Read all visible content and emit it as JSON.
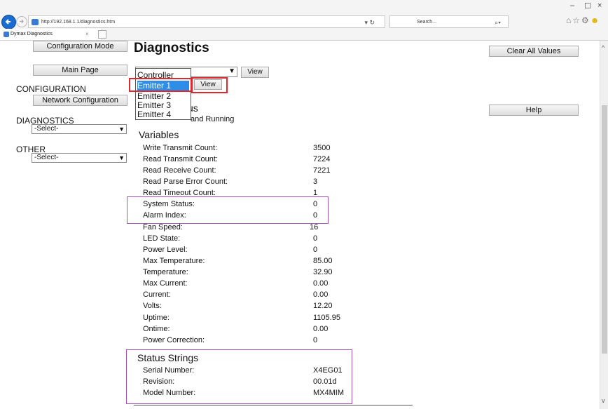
{
  "browser": {
    "url": "http://192.168.1.1/diagnostics.htm",
    "refresh_icon": "refresh-icon",
    "search_placeholder": "Search...",
    "search_icon": "search-icon",
    "tab_title": "Dymax Diagnostics",
    "tab_close": "×",
    "window_controls": {
      "minimize": "–",
      "maximize": "☐",
      "close": "×"
    },
    "toolbar_icons": [
      "home-icon",
      "star-icon",
      "gear-icon",
      "smiley-icon"
    ]
  },
  "sidebar": {
    "configuration_mode": "Configuration Mode",
    "main_page": "Main Page",
    "configuration_heading": "CONFIGURATION",
    "network_configuration": "Network Configuration",
    "diagnostics_heading": "DIAGNOSTICS",
    "diagnostics_select": "-Select-",
    "other_heading": "OTHER",
    "other_select": "-Select-"
  },
  "main": {
    "title": "Diagnostics",
    "view_button": "View",
    "view_button_2": "View",
    "clear_all": "Clear All Values",
    "help": "Help",
    "dropdown_options": [
      "Controller",
      "Emitter 1",
      "Emitter 2",
      "Emitter 3",
      "Emitter 4"
    ],
    "dropdown_selected": "Emitter 1",
    "status_heading_partial": "us",
    "status_text_partial": "and Running",
    "variables_heading": "Variables",
    "variables": [
      {
        "label": "Write Transmit Count:",
        "value": "3500"
      },
      {
        "label": "Read Transmit Count:",
        "value": "7224"
      },
      {
        "label": "Read Receive Count:",
        "value": "7221"
      },
      {
        "label": "Read Parse Error Count:",
        "value": "3"
      },
      {
        "label": "Read Timeout Count:",
        "value": "1"
      },
      {
        "label": "System Status:",
        "value": "0"
      },
      {
        "label": "Alarm Index:",
        "value": "0"
      },
      {
        "label": "Fan Speed:",
        "value": "16"
      },
      {
        "label": "LED State:",
        "value": "0"
      },
      {
        "label": "Power Level:",
        "value": "0"
      },
      {
        "label": "Max Temperature:",
        "value": "85.00"
      },
      {
        "label": "Temperature:",
        "value": "32.90"
      },
      {
        "label": "Max Current:",
        "value": "0.00"
      },
      {
        "label": "Current:",
        "value": "0.00"
      },
      {
        "label": "Volts:",
        "value": "12.20"
      },
      {
        "label": "Uptime:",
        "value": "1105.95"
      },
      {
        "label": "Ontime:",
        "value": "0.00"
      },
      {
        "label": "Power Correction:",
        "value": "0"
      }
    ],
    "status_strings_heading": "Status Strings",
    "status_strings": [
      {
        "label": "Serial Number:",
        "value": "X4EG01"
      },
      {
        "label": "Revision:",
        "value": "00.01d"
      },
      {
        "label": "Model Number:",
        "value": "MX4MIM"
      }
    ]
  },
  "colors": {
    "highlight_red": "#e0282e",
    "highlight_purple": "#a252b8",
    "selection_blue": "#2e8de6"
  }
}
